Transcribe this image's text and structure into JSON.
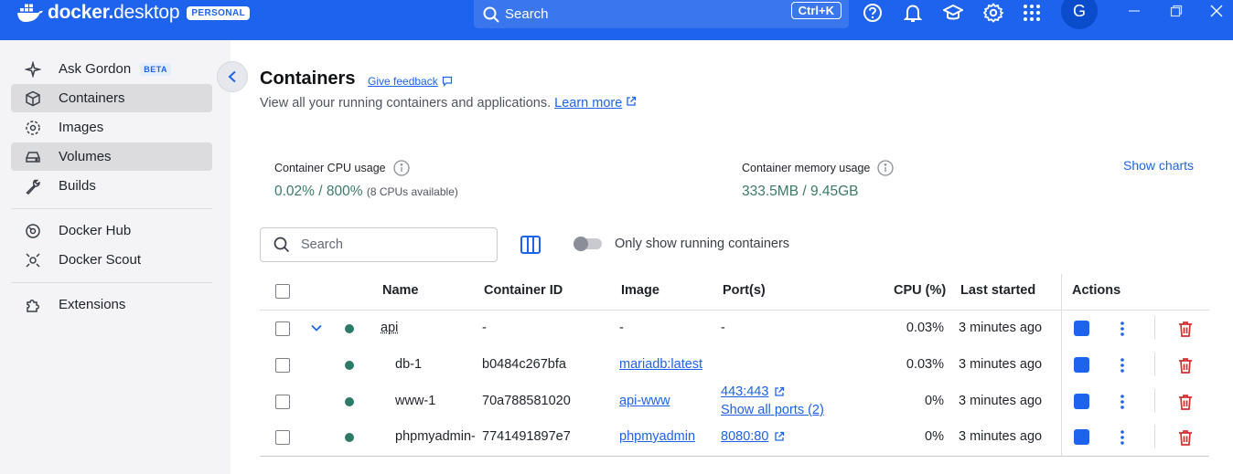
{
  "topbar": {
    "logo_prefix": "docker.",
    "logo_suffix": "desktop",
    "plan_badge": "PERSONAL",
    "search_label": "Search",
    "search_shortcut": "Ctrl+K",
    "avatar_letter": "G",
    "colors": {
      "bar": "#1d63ed"
    }
  },
  "sidebar": {
    "items": [
      {
        "label": "Ask Gordon",
        "badge": "BETA",
        "icon": "sparkle-icon"
      },
      {
        "label": "Containers",
        "icon": "cube-icon"
      },
      {
        "label": "Images",
        "icon": "images-icon"
      },
      {
        "label": "Volumes",
        "icon": "drive-icon"
      },
      {
        "label": "Builds",
        "icon": "wrench-icon"
      },
      {
        "label": "Docker Hub",
        "icon": "hub-icon"
      },
      {
        "label": "Docker Scout",
        "icon": "scout-icon"
      },
      {
        "label": "Extensions",
        "icon": "puzzle-icon"
      }
    ]
  },
  "main": {
    "title": "Containers",
    "feedback": "Give feedback",
    "subtitle": "View all your running containers and applications.",
    "learn_more": "Learn more",
    "cpu_label": "Container CPU usage",
    "cpu_value": "0.02% / 800%",
    "cpu_note": "(8 CPUs available)",
    "mem_label": "Container memory usage",
    "mem_value": "333.5MB / 9.45GB",
    "show_charts": "Show charts",
    "search_placeholder": "Search",
    "toggle_label": "Only show running containers"
  },
  "table": {
    "headers": [
      "Name",
      "Container ID",
      "Image",
      "Port(s)",
      "CPU (%)",
      "Last started",
      "Actions"
    ],
    "rows": [
      {
        "name": "api",
        "id": "-",
        "image": "-",
        "port": "-",
        "port_extra": "",
        "cpu": "0.03%",
        "started": "3 minutes ago"
      },
      {
        "name": "db-1",
        "id": "b0484c267bfa",
        "image": "mariadb:latest",
        "port": "",
        "port_extra": "",
        "cpu": "0.03%",
        "started": "3 minutes ago"
      },
      {
        "name": "www-1",
        "id": "70a788581020",
        "image": "api-www",
        "port": "443:443",
        "port_extra": "Show all ports (2)",
        "cpu": "0%",
        "started": "3 minutes ago"
      },
      {
        "name": "phpmyadmin-",
        "id": "7741491897e7",
        "image": "phpmyadmin",
        "port": "8080:80",
        "port_extra": "",
        "cpu": "0%",
        "started": "3 minutes ago"
      }
    ]
  }
}
